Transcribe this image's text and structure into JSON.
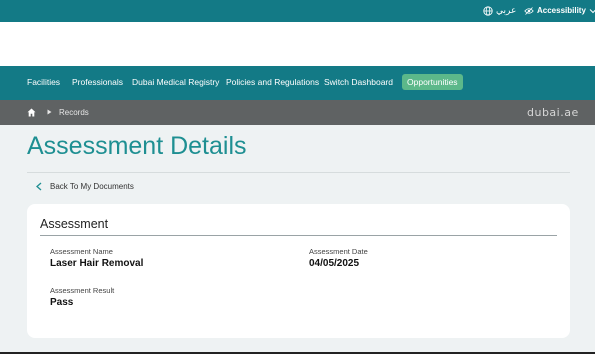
{
  "topbar": {
    "language_label": "عربي",
    "accessibility_label": "Accessibility"
  },
  "nav": {
    "items": [
      {
        "label": "Facilities"
      },
      {
        "label": "Professionals"
      },
      {
        "label": "Dubai Medical Registry"
      },
      {
        "label": "Policies and Regulations"
      },
      {
        "label": "Switch Dashboard"
      },
      {
        "label": "Opportunities"
      }
    ]
  },
  "breadcrumb": {
    "current": "Records",
    "logo_text": "dubai.ae"
  },
  "page": {
    "title": "Assessment Details",
    "back_label": "Back To My Documents"
  },
  "card": {
    "title": "Assessment",
    "fields": [
      {
        "label": "Assessment Name",
        "value": "Laser Hair Removal"
      },
      {
        "label": "Assessment Date",
        "value": "04/05/2025"
      },
      {
        "label": "Assessment Result",
        "value": "Pass"
      }
    ]
  },
  "colors": {
    "brand_teal": "#137a86",
    "title_teal": "#1e8f92",
    "active_green": "#5cb88a",
    "breadcrumb_gray": "#5f6263"
  }
}
